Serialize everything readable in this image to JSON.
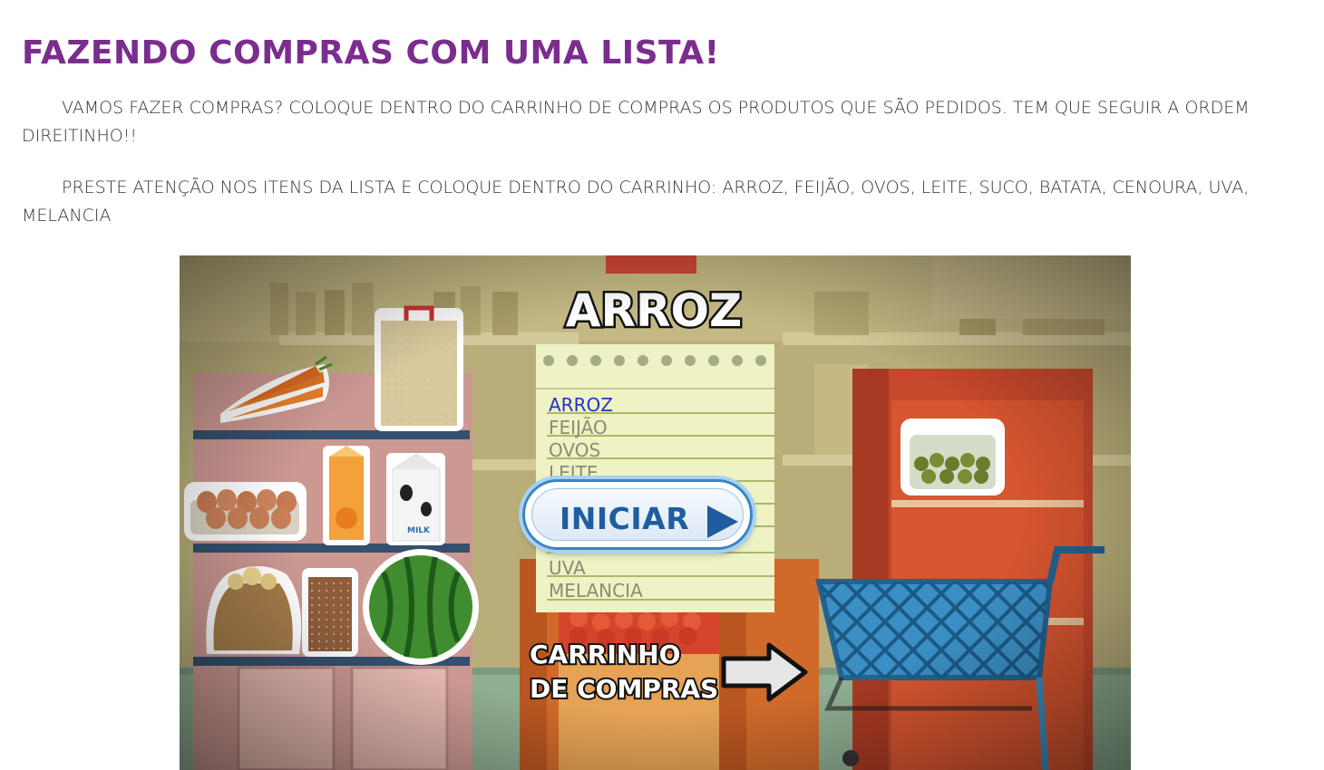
{
  "page": {
    "title": "FAZENDO COMPRAS COM UMA LISTA!",
    "paragraph1": "VAMOS FAZER COMPRAS? COLOQUE DENTRO DO CARRINHO DE COMPRAS OS PRODUTOS QUE SÃO PEDIDOS. TEM QUE SEGUIR A ORDEM DIREITINHO!!",
    "paragraph2": "PRESTE ATENÇÃO NOS ITENS DA LISTA E COLOQUE DENTRO DO CARRINHO: ARROZ, FEIJÃO, OVOS, LEITE, SUCO, BATATA, CENOURA, UVA, MELANCIA"
  },
  "game": {
    "current_item": "ARROZ",
    "start_button": "INICIAR",
    "cart_label_line1": "CARRINHO",
    "cart_label_line2": "DE COMPRAS",
    "list_items": [
      "ARROZ",
      "FEIJÃO",
      "OVOS",
      "LEITE",
      "UVA",
      "MELANCIA"
    ],
    "milk_label": "MILK",
    "colors": {
      "title": "#7b2d8e",
      "list_active": "#2233cc",
      "list_inactive": "#8c8c74",
      "button_text": "#1f5d9e",
      "cart": "#3b8fc4"
    }
  }
}
